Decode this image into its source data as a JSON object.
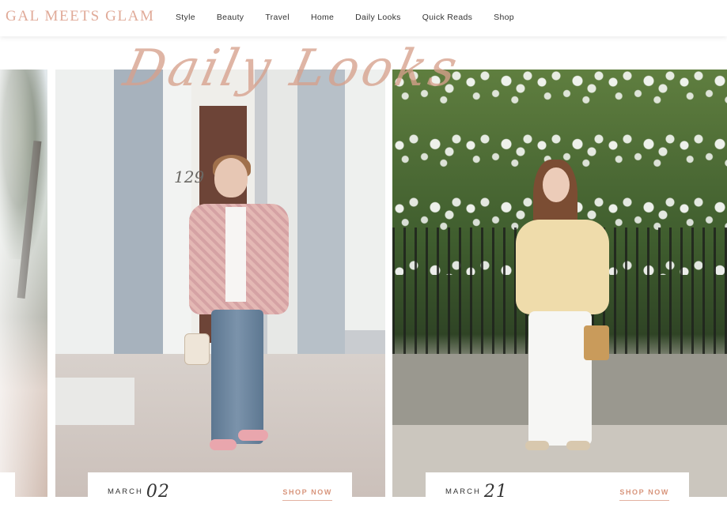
{
  "brand": {
    "logo": "GAL MEETS GLAM",
    "accent_color": "#e0aa98"
  },
  "nav": {
    "items": [
      {
        "label": "Style"
      },
      {
        "label": "Beauty"
      },
      {
        "label": "Travel"
      },
      {
        "label": "Home"
      },
      {
        "label": "Daily Looks"
      },
      {
        "label": "Quick Reads"
      },
      {
        "label": "Shop"
      }
    ]
  },
  "hero": {
    "script_title": "Daily Looks"
  },
  "slides": {
    "left": {
      "icon": "street-photo"
    },
    "mid": {
      "month": "MARCH",
      "day": "02",
      "cta": "SHOP NOW",
      "house_number": "129"
    },
    "right": {
      "month": "MARCH",
      "day": "21",
      "cta": "SHOP NOW"
    }
  }
}
